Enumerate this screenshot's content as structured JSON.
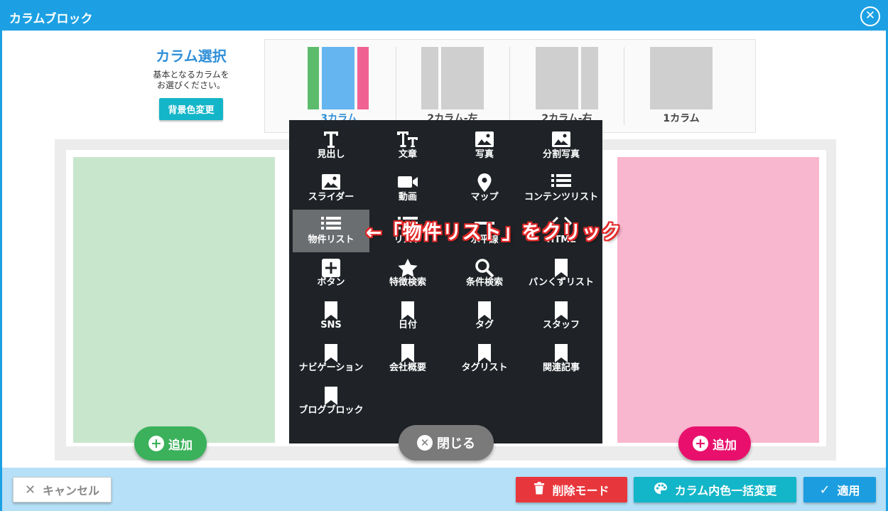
{
  "dialog": {
    "title": "カラムブロック",
    "close_icon": "close-circle-icon"
  },
  "column_select": {
    "heading": "カラム選択",
    "desc_line1": "基本となるカラムを",
    "desc_line2": "お選びください。",
    "bg_button": "背景色変更"
  },
  "layouts": [
    {
      "label": "3カラム",
      "selected": true
    },
    {
      "label": "2カラム-左",
      "selected": false
    },
    {
      "label": "2カラム-右",
      "selected": false
    },
    {
      "label": "1カラム",
      "selected": false
    }
  ],
  "colors": {
    "accent": "#1ca0e3",
    "col_green": "#c8e6cc",
    "col_pink": "#f9b6cf",
    "thumb_green": "#5cbc6c",
    "thumb_blue": "#64b5f0",
    "thumb_pink": "#f06292",
    "add_green": "#3ab15a",
    "add_pink": "#e8106c",
    "delete_red": "#e8373c",
    "color_change_teal": "#13b5c8",
    "apply_blue": "#1c9de0"
  },
  "palette": {
    "items": [
      {
        "label": "見出し",
        "icon": "title-t-icon"
      },
      {
        "label": "文章",
        "icon": "text-tt-icon"
      },
      {
        "label": "写真",
        "icon": "image-icon"
      },
      {
        "label": "分割写真",
        "icon": "image-icon"
      },
      {
        "label": "スライダー",
        "icon": "image-icon"
      },
      {
        "label": "動画",
        "icon": "video-camera-icon"
      },
      {
        "label": "マップ",
        "icon": "map-pin-icon"
      },
      {
        "label": "コンテンツリスト",
        "icon": "list-icon"
      },
      {
        "label": "物件リスト",
        "icon": "list-icon",
        "highlighted": true
      },
      {
        "label": "リスト",
        "icon": "list-icon"
      },
      {
        "label": "水平線",
        "icon": "horizontal-line-icon"
      },
      {
        "label": "HTML",
        "icon": "code-icon"
      },
      {
        "label": "ボタン",
        "icon": "plus-square-icon"
      },
      {
        "label": "特徴検索",
        "icon": "star-icon"
      },
      {
        "label": "条件検索",
        "icon": "search-icon"
      },
      {
        "label": "パンくずリスト",
        "icon": "bookmark-icon"
      },
      {
        "label": "SNS",
        "icon": "bookmark-icon"
      },
      {
        "label": "日付",
        "icon": "bookmark-icon"
      },
      {
        "label": "タグ",
        "icon": "bookmark-icon"
      },
      {
        "label": "スタッフ",
        "icon": "bookmark-icon"
      },
      {
        "label": "ナビゲーション",
        "icon": "bookmark-icon"
      },
      {
        "label": "会社概要",
        "icon": "bookmark-icon"
      },
      {
        "label": "タグリスト",
        "icon": "bookmark-icon"
      },
      {
        "label": "関連記事",
        "icon": "bookmark-icon"
      },
      {
        "label": "ブログブロック",
        "icon": "bookmark-icon"
      }
    ]
  },
  "annotation": "←「物件リスト」をクリック",
  "buttons": {
    "add_left": "追加",
    "add_right": "追加",
    "close": "閉じる",
    "cancel": "キャンセル",
    "delete_mode": "削除モード",
    "color_bulk": "カラム内色一括変更",
    "apply": "適用"
  }
}
